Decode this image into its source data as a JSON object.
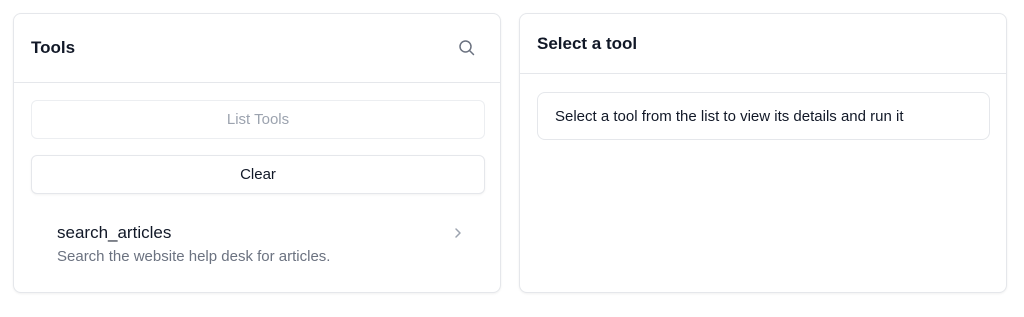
{
  "tools_panel": {
    "title": "Tools",
    "search_icon": "search-icon",
    "list_tools_label": "List Tools",
    "clear_label": "Clear",
    "tools": [
      {
        "name": "search_articles",
        "description": "Search the website help desk for articles.",
        "icon": "chevron-right-icon"
      }
    ]
  },
  "details_panel": {
    "title": "Select a tool",
    "message": "Select a tool from the list to view its details and run it"
  },
  "colors": {
    "border": "#e5e7eb",
    "text_primary": "#111827",
    "text_muted": "#6b7280",
    "text_disabled": "#9ca3af"
  }
}
